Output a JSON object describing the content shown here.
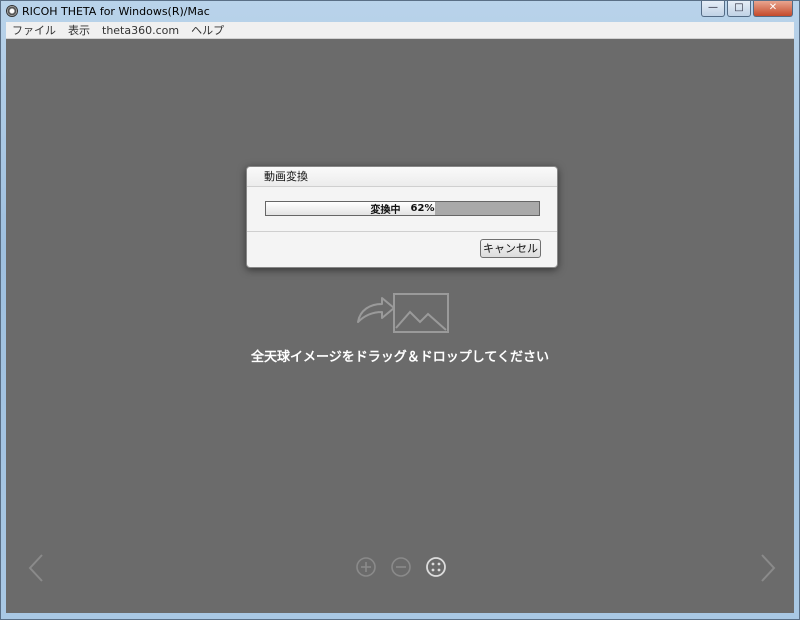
{
  "window": {
    "title": "RICOH THETA for Windows(R)/Mac",
    "controls": [
      "—",
      "□",
      "✕"
    ]
  },
  "menu": [
    "ファイル",
    "表示",
    "theta360.com",
    "ヘルプ"
  ],
  "dialog": {
    "title": "動画変換",
    "status": "変換中",
    "percent_label": "62%",
    "progress": 0.62,
    "cancel_label": "キャンセル"
  },
  "dropzone": {
    "message": "全天球イメージをドラッグ＆ドロップしてください",
    "icon": "image-import-icon"
  },
  "controls": {
    "icons": [
      "chevron-left-icon",
      "zoom-in-icon",
      "zoom-out-icon",
      "fit-view-icon",
      "chevron-right-icon"
    ]
  },
  "colors": {
    "background": "#6b6b6b",
    "progress_fill": "#f2f2f2",
    "progress_track": "#a9a9a9"
  }
}
